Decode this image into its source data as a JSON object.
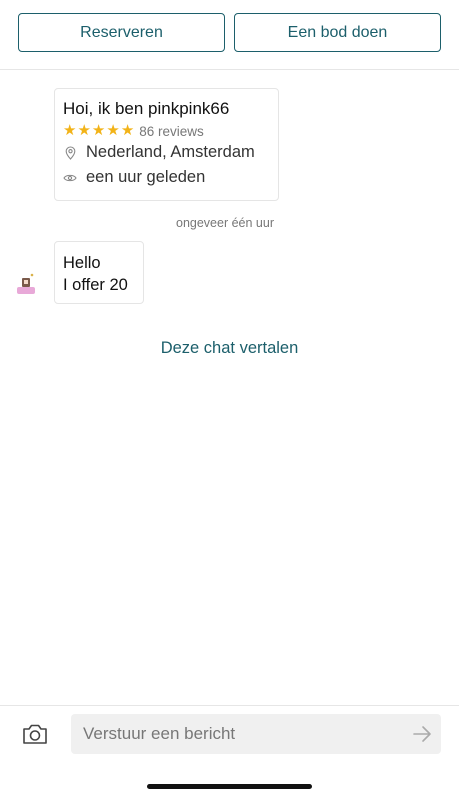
{
  "actions": {
    "reserve_label": "Reserveren",
    "offer_label": "Een bod doen"
  },
  "profile": {
    "greeting": "Hoi, ik ben pinkpink66",
    "stars": 5,
    "reviews": "86 reviews",
    "location": "Nederland, Amsterdam",
    "last_seen": "een uur geleden"
  },
  "chat": {
    "timestamp": "ongeveer één uur",
    "message": {
      "lines": [
        "Hello",
        "I offer 20"
      ]
    },
    "translate_label": "Deze chat vertalen"
  },
  "composer": {
    "placeholder": "Verstuur een bericht",
    "value": ""
  },
  "icons": {
    "star": "star-icon",
    "location": "location-pin-icon",
    "eye": "eye-icon",
    "camera": "camera-icon",
    "send": "send-arrow-icon"
  },
  "colors": {
    "accent": "#1c5f6b",
    "star": "#f2b318"
  }
}
